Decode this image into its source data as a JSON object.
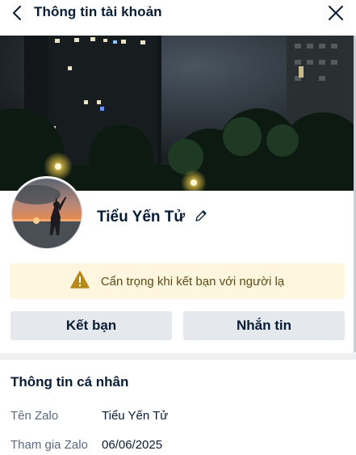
{
  "header": {
    "title": "Thông tin tài khoản",
    "back_icon": "chevron-left-icon",
    "close_icon": "close-icon"
  },
  "profile": {
    "display_name": "Tiểu Yến Tử",
    "edit_icon": "pencil-icon"
  },
  "warning": {
    "icon": "warning-triangle-icon",
    "text": "Cẩn trọng khi kết bạn với người lạ",
    "background_color": "#fff6df",
    "icon_color": "#e5a400"
  },
  "actions": {
    "add_friend_label": "Kết bạn",
    "message_label": "Nhắn tin"
  },
  "personal_info": {
    "title": "Thông tin cá nhân",
    "rows": [
      {
        "label": "Tên Zalo",
        "value": "Tiểu Yến Tử"
      },
      {
        "label": "Tham gia Zalo",
        "value": "06/06/2025"
      }
    ]
  },
  "colors": {
    "text_primary": "#081c36",
    "text_secondary": "#5a6981",
    "button_bg": "#e5e8ec"
  }
}
